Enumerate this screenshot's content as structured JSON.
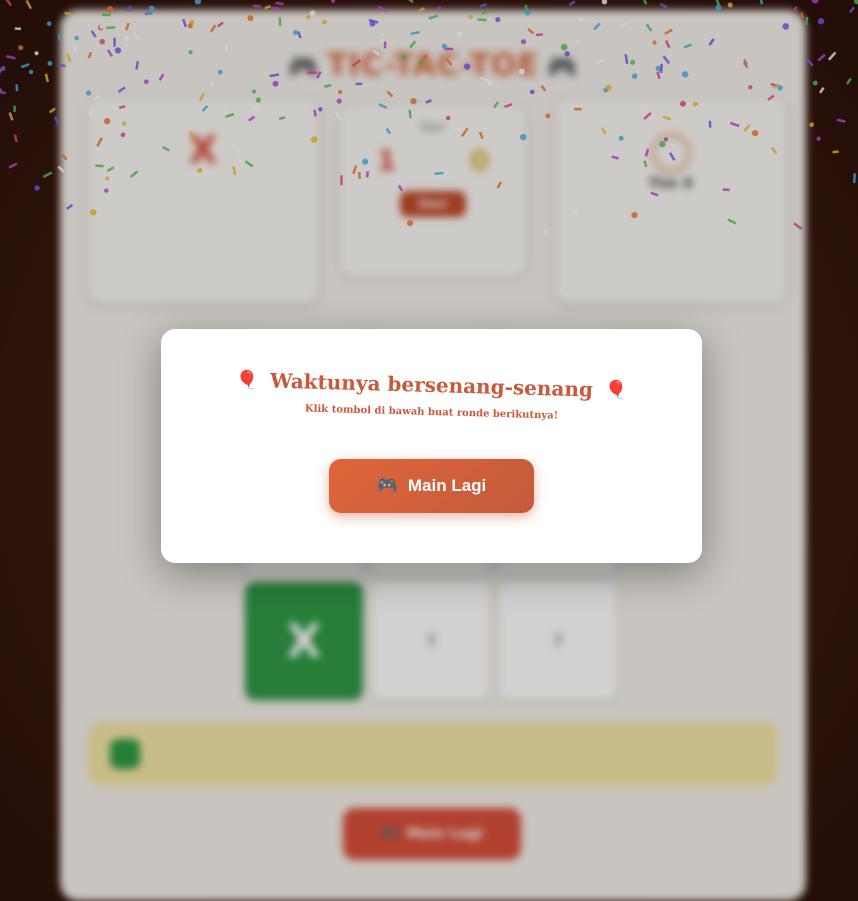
{
  "app": {
    "title": "TIC-TAC-TOE",
    "title_icon": "gamepad-icon",
    "player1": {
      "mark": "X",
      "name": "",
      "stat": ""
    },
    "player2": {
      "mark": "◯",
      "name": "Tim X",
      "stat": ""
    },
    "score": {
      "title": "Skor",
      "left": "1",
      "right": "0",
      "left_label": "",
      "right_label": "",
      "reset_label": "Skor"
    },
    "board": [
      "",
      "",
      "",
      "",
      "",
      "",
      "X",
      "?",
      "?"
    ],
    "status_text": "",
    "bottom_button": "Main Lagi"
  },
  "modal": {
    "title": "Waktunya bersenang-senang",
    "title_icon": "balloons-icon",
    "subtitle": "Klik tombol di bawah buat ronde berikutnya!",
    "button_label": "Main Lagi",
    "button_icon": "gamepad-icon"
  },
  "colors": {
    "accent": "#c9593a",
    "button_start": "#e0663a",
    "button_end": "#c45a3c",
    "x_cell": "#2f9a45",
    "status_bg": "#f5e7a6"
  }
}
